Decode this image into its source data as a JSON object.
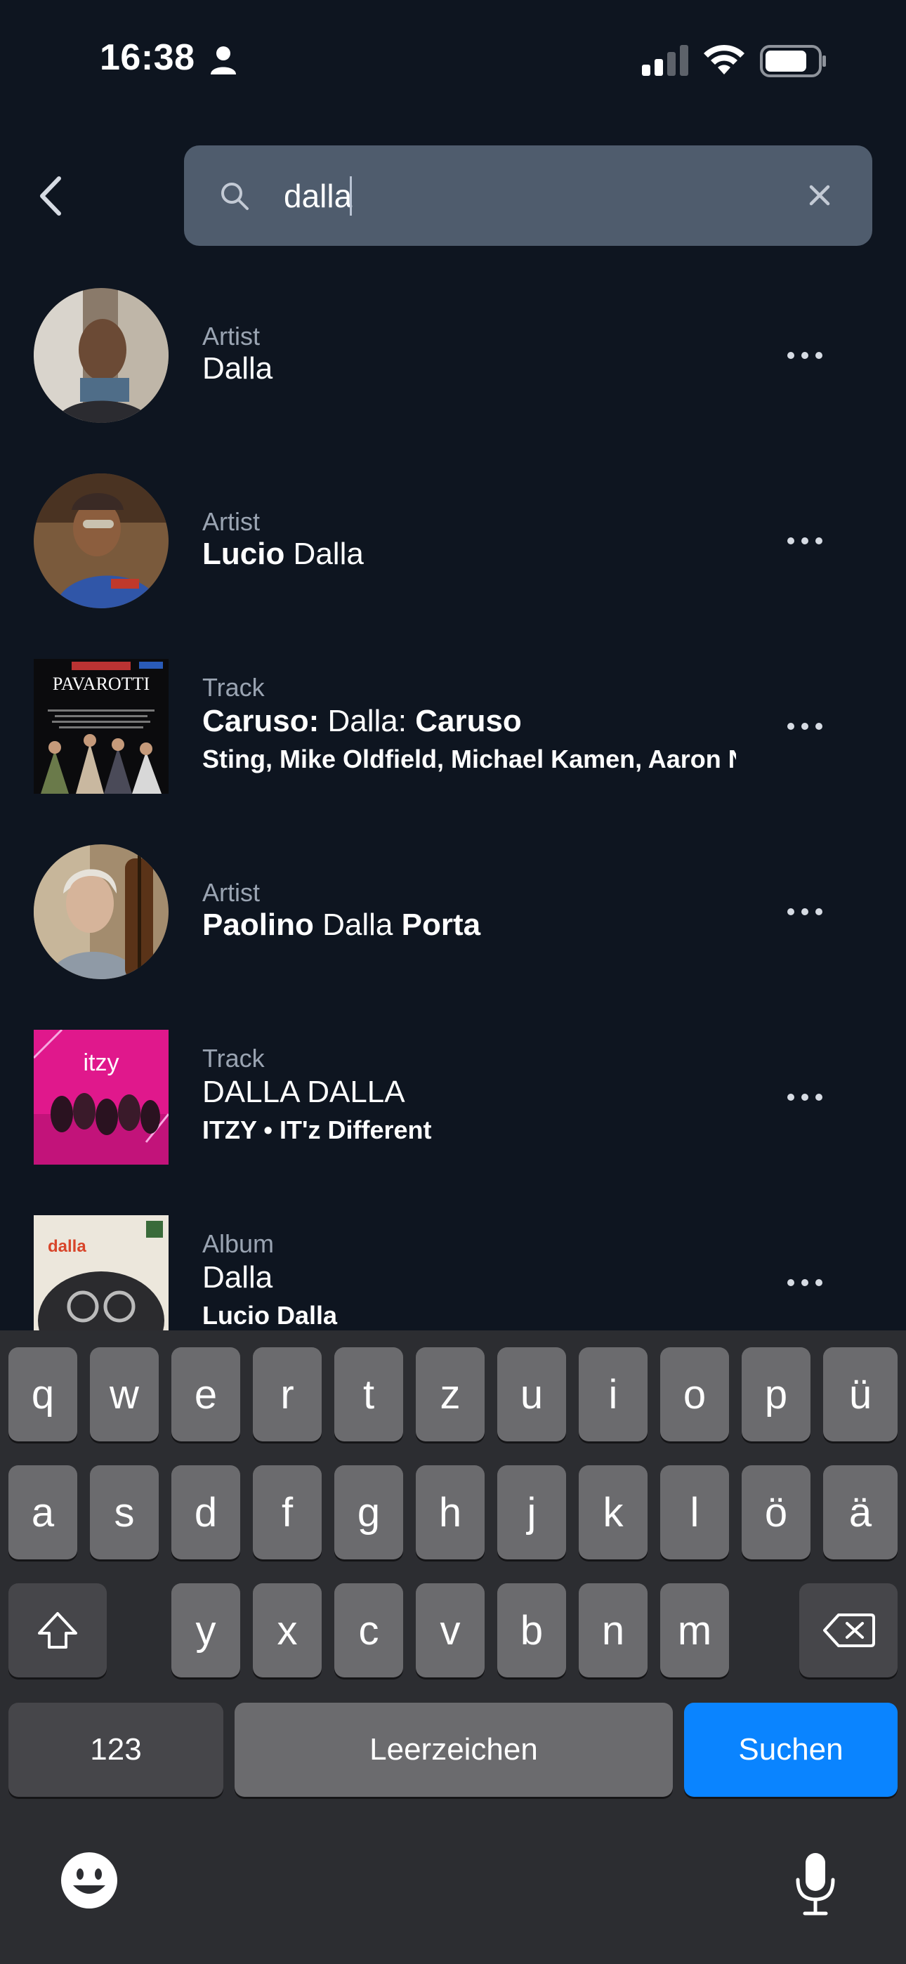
{
  "status_bar": {
    "time": "16:38",
    "icons": [
      "person-icon",
      "signal-icon",
      "wifi-icon",
      "battery-icon"
    ]
  },
  "search": {
    "query": "dalla",
    "icons": [
      "chevron-left-icon",
      "search-icon",
      "close-icon"
    ]
  },
  "results": [
    {
      "type": "Artist",
      "title_parts": [
        {
          "t": "Dalla",
          "b": false
        }
      ],
      "subtitle": ""
    },
    {
      "type": "Artist",
      "title_parts": [
        {
          "t": "Lucio",
          "b": true
        },
        {
          "t": " Dalla",
          "b": false
        }
      ],
      "subtitle": ""
    },
    {
      "type": "Track",
      "title_parts": [
        {
          "t": "Caruso:",
          "b": true
        },
        {
          "t": " Dalla: ",
          "b": false
        },
        {
          "t": "Caruso",
          "b": true
        }
      ],
      "subtitle": "Sting, Mike Oldfield, Michael Kamen, Aaron Nev",
      "cover_text": "PAVAROTTI"
    },
    {
      "type": "Artist",
      "title_parts": [
        {
          "t": "Paolino",
          "b": true
        },
        {
          "t": " Dalla ",
          "b": false
        },
        {
          "t": "Porta",
          "b": true
        }
      ],
      "subtitle": ""
    },
    {
      "type": "Track",
      "title_parts": [
        {
          "t": "DALLA DALLA",
          "b": false
        }
      ],
      "subtitle": "ITZY • IT'z Different",
      "cover_text": "itzy"
    },
    {
      "type": "Album",
      "title_parts": [
        {
          "t": "Dalla",
          "b": false
        }
      ],
      "subtitle": "Lucio Dalla",
      "cover_text": "dalla"
    }
  ],
  "keyboard": {
    "row1": [
      "q",
      "w",
      "e",
      "r",
      "t",
      "z",
      "u",
      "i",
      "o",
      "p",
      "ü"
    ],
    "row2": [
      "a",
      "s",
      "d",
      "f",
      "g",
      "h",
      "j",
      "k",
      "l",
      "ö",
      "ä"
    ],
    "row3": [
      "y",
      "x",
      "c",
      "v",
      "b",
      "n",
      "m"
    ],
    "numbers_label": "123",
    "space_label": "Leerzeichen",
    "search_label": "Suchen",
    "icons": [
      "shift-icon",
      "backspace-icon",
      "emoji-icon",
      "microphone-icon"
    ]
  },
  "colors": {
    "background": "#0e1520",
    "search_field": "#4f5c6d",
    "secondary_text": "#9aa4b2",
    "keyboard": "#2c2d31",
    "key": "#6b6b6e",
    "key_dark": "#46464a",
    "accent": "#0a84ff"
  }
}
